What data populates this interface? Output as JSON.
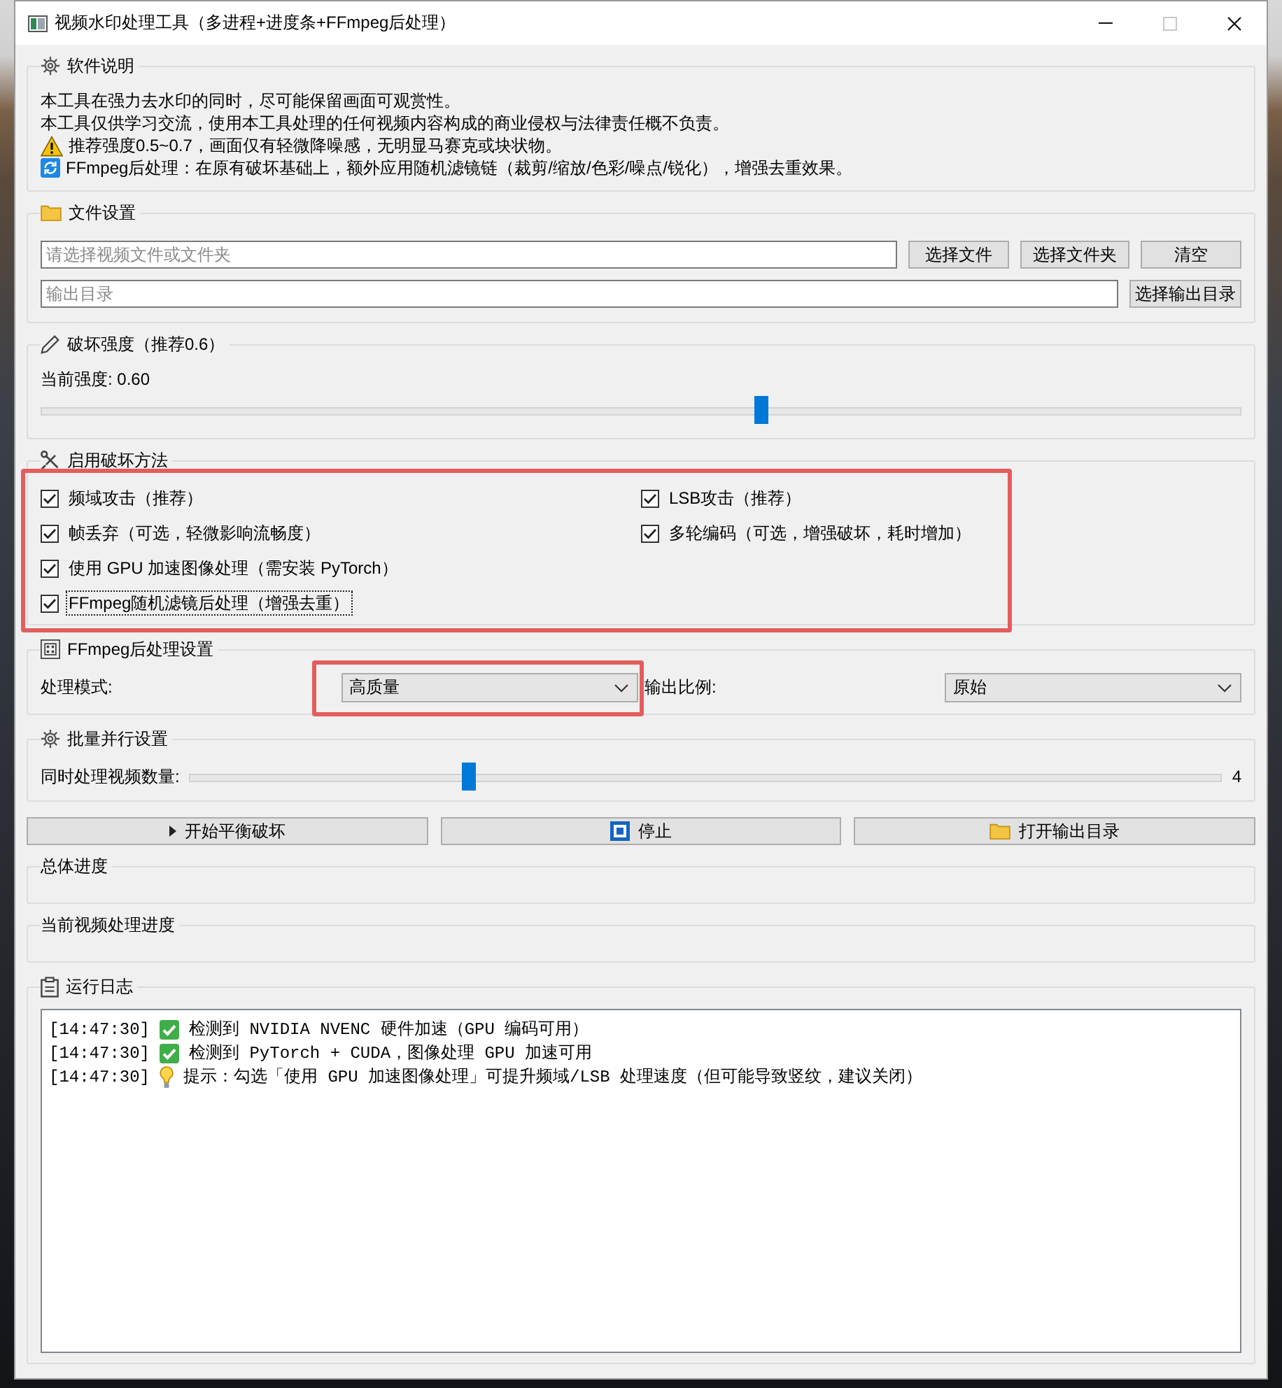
{
  "window": {
    "title": "视频水印处理工具（多进程+进度条+FFmpeg后处理）",
    "controls": [
      {
        "kind": "minimize",
        "disabled": false
      },
      {
        "kind": "maximize",
        "disabled": true
      },
      {
        "kind": "close",
        "disabled": false
      }
    ]
  },
  "about": {
    "title": "软件说明",
    "lines": [
      {
        "kind": "plain",
        "text": "本工具在强力去水印的同时，尽可能保留画面可观赏性。"
      },
      {
        "kind": "plain",
        "text": "本工具仅供学习交流，使用本工具处理的任何视频内容构成的商业侵权与法律责任概不负责。"
      },
      {
        "kind": "warning",
        "text": "推荐强度0.5~0.7，画面仅有轻微降噪感，无明显马赛克或块状物。"
      },
      {
        "kind": "refresh",
        "text": "FFmpeg后处理：在原有破坏基础上，额外应用随机滤镜链（裁剪/缩放/色彩/噪点/锐化），增强去重效果。"
      }
    ]
  },
  "file_settings": {
    "title": "文件设置",
    "input": {
      "placeholder": "请选择视频文件或文件夹"
    },
    "input_buttons": [
      "选择文件",
      "选择文件夹",
      "清空"
    ],
    "output": {
      "placeholder": "输出目录"
    },
    "output_button": "选择输出目录"
  },
  "strength": {
    "title": "破坏强度（推荐0.6）",
    "reading": "当前强度: 0.60",
    "level": 0.6
  },
  "methods": {
    "title": "启用破坏方法",
    "highlighted": true,
    "rows": [
      {
        "options": [
          {
            "label": "频域攻击（推荐）",
            "checked": true,
            "focused": false
          },
          {
            "label": "LSB攻击（推荐）",
            "checked": true,
            "focused": false
          }
        ]
      },
      {
        "options": [
          {
            "label": "帧丢弃（可选，轻微影响流畅度）",
            "checked": true,
            "focused": false
          },
          {
            "label": "多轮编码（可选，增强破坏，耗时增加）",
            "checked": true,
            "focused": false
          }
        ]
      },
      {
        "options": [
          {
            "label": "使用 GPU 加速图像处理（需安装 PyTorch）",
            "checked": true,
            "focused": false
          }
        ]
      },
      {
        "options": [
          {
            "label": "FFmpeg随机滤镜后处理（增强去重）",
            "checked": true,
            "focused": true
          }
        ]
      }
    ]
  },
  "ffmpeg_settings": {
    "title": "FFmpeg后处理设置",
    "fields": [
      {
        "label": "处理模式:",
        "value": "高质量",
        "highlighted": true
      },
      {
        "label": "输出比例:",
        "value": "原始",
        "highlighted": false
      }
    ]
  },
  "batch": {
    "title": "批量并行设置",
    "label": "同时处理视频数量:",
    "level": 0.27,
    "reading": "4"
  },
  "actions": [
    {
      "kind": "start",
      "label": "开始平衡破坏"
    },
    {
      "kind": "stop",
      "label": "停止"
    },
    {
      "kind": "open",
      "label": "打开输出目录"
    }
  ],
  "progress": [
    {
      "title": "总体进度"
    },
    {
      "title": "当前视频处理进度"
    }
  ],
  "log": {
    "title": "运行日志",
    "lines": [
      {
        "time": "[14:47:30]",
        "kind": "ok",
        "text": "检测到 NVIDIA NVENC 硬件加速（GPU 编码可用）"
      },
      {
        "time": "[14:47:30]",
        "kind": "ok",
        "text": "检测到 PyTorch + CUDA，图像处理 GPU 加速可用"
      },
      {
        "time": "[14:47:30]",
        "kind": "tip",
        "text": "提示：勾选「使用 GPU 加速图像处理」可提升频域/LSB 处理速度（但可能导致竖纹，建议关闭）"
      }
    ]
  }
}
